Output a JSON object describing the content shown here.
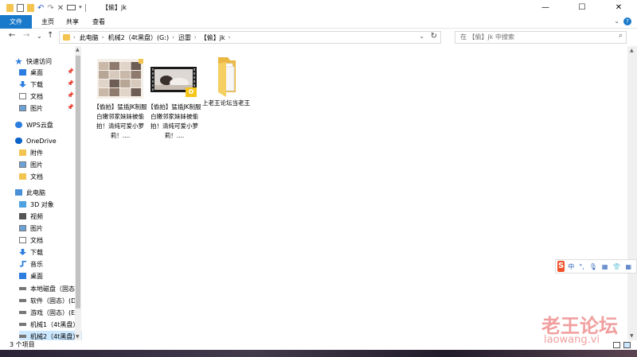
{
  "window": {
    "title": "【偷】jk",
    "controls": {
      "minimize": "—",
      "maximize": "☐",
      "close": "✕"
    }
  },
  "ribbon": {
    "tabs": [
      "文件",
      "主页",
      "共享",
      "查看"
    ],
    "help": "?"
  },
  "navigation": {
    "back": "←",
    "forward": "→",
    "recent": "⌄",
    "up": "↑",
    "breadcrumbs": [
      "此电脑",
      "机械2（4t黑盘）(G:)",
      "迅雷",
      "【偷】jk"
    ],
    "search_placeholder": "在 【偷】jk 中搜索"
  },
  "sidebar": {
    "items": [
      {
        "label": "快速访问",
        "icon": "star-icon",
        "indent": 0
      },
      {
        "label": "桌面",
        "icon": "desktop-icon",
        "indent": 1,
        "pinned": true
      },
      {
        "label": "下载",
        "icon": "download-icon",
        "indent": 1,
        "pinned": true
      },
      {
        "label": "文档",
        "icon": "document-icon",
        "indent": 1,
        "pinned": true
      },
      {
        "label": "图片",
        "icon": "picture-icon",
        "indent": 1,
        "pinned": true
      },
      {
        "label": "WPS云盘",
        "icon": "cloud-icon",
        "indent": 0
      },
      {
        "label": "OneDrive",
        "icon": "onedrive-icon",
        "indent": 0
      },
      {
        "label": "附件",
        "icon": "folder-icon",
        "indent": 1
      },
      {
        "label": "图片",
        "icon": "picture-icon",
        "indent": 1
      },
      {
        "label": "文档",
        "icon": "folder-icon",
        "indent": 1
      },
      {
        "label": "此电脑",
        "icon": "computer-icon",
        "indent": 0
      },
      {
        "label": "3D 对象",
        "icon": "3d-objects-icon",
        "indent": 1
      },
      {
        "label": "视频",
        "icon": "video-icon",
        "indent": 1
      },
      {
        "label": "图片",
        "icon": "picture-icon",
        "indent": 1
      },
      {
        "label": "文档",
        "icon": "document-icon",
        "indent": 1
      },
      {
        "label": "下载",
        "icon": "download-icon",
        "indent": 1
      },
      {
        "label": "音乐",
        "icon": "music-icon",
        "indent": 1
      },
      {
        "label": "桌面",
        "icon": "desktop-icon",
        "indent": 1
      },
      {
        "label": "本地磁盘（固态",
        "icon": "drive-icon",
        "indent": 1
      },
      {
        "label": "软件（固态）(D",
        "icon": "drive-icon",
        "indent": 1
      },
      {
        "label": "游戏（固态）(E",
        "icon": "drive-icon",
        "indent": 1
      },
      {
        "label": "机械1（4t黑盘）",
        "icon": "drive-icon",
        "indent": 1
      },
      {
        "label": "机械2（4t黑盘）",
        "icon": "drive-icon",
        "indent": 1,
        "selected": true
      }
    ]
  },
  "files": [
    {
      "name": "【偷拍】猛插JK制服白嫩邻家妹妹被偷拍！清纯可爱小萝莉！....",
      "type": "image-collage"
    },
    {
      "name": "【偷拍】猛插JK制服白嫩邻家妹妹被偷拍！清纯可爱小萝莉！....",
      "type": "video"
    },
    {
      "name": "上老王论坛当老王",
      "type": "folder"
    }
  ],
  "status": {
    "count": "3 个项目"
  },
  "ime": {
    "logo": "S",
    "mode": "中",
    "punct": "°,",
    "mic": "🎙",
    "keyboard": "▦",
    "shirt": "👕",
    "apps": "▦"
  },
  "watermark": {
    "title": "老王论坛",
    "url": "laowang.vi"
  },
  "colors": {
    "accent": "#1979ca",
    "folder": "#f3c44f",
    "selected": "#cce8ff"
  }
}
